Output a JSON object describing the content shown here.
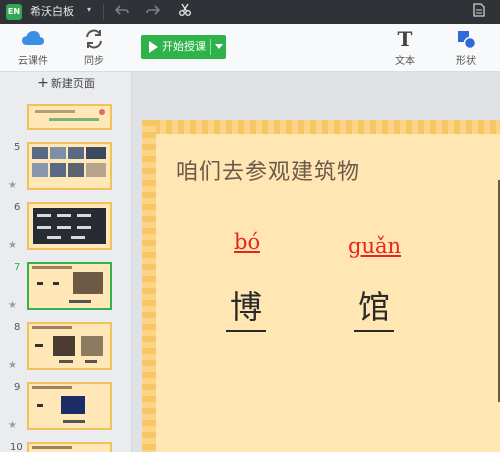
{
  "app": {
    "logo_text": "EN",
    "title": "希沃白板",
    "menu_caret": "▾"
  },
  "titlebar_icons": [
    "undo-icon",
    "redo-icon",
    "scissors-icon",
    "document-icon"
  ],
  "toolbar": {
    "cloud_label": "云课件",
    "sync_label": "同步",
    "start_label": "开始授课",
    "text_label": "文本",
    "shape_label": "形状",
    "text_glyph": "T"
  },
  "sidebar": {
    "new_page_plus": "+",
    "new_page_label": "新建页面",
    "slides": [
      {
        "num": "5",
        "active": false
      },
      {
        "num": "6",
        "active": false
      },
      {
        "num": "7",
        "active": true
      },
      {
        "num": "8",
        "active": false
      },
      {
        "num": "9",
        "active": false
      },
      {
        "num": "10",
        "active": false
      }
    ],
    "star_glyph": "★"
  },
  "slide": {
    "title": "咱们去参观建筑物",
    "pinyin_1": "bó",
    "hanzi_1": "博",
    "pinyin_2": "guǎn",
    "hanzi_2": "馆"
  },
  "colors": {
    "accent_green": "#2eb34a",
    "pinyin_red": "#e8251c",
    "slide_bg": "#ffe6b3",
    "stripe": "#f7c766"
  }
}
